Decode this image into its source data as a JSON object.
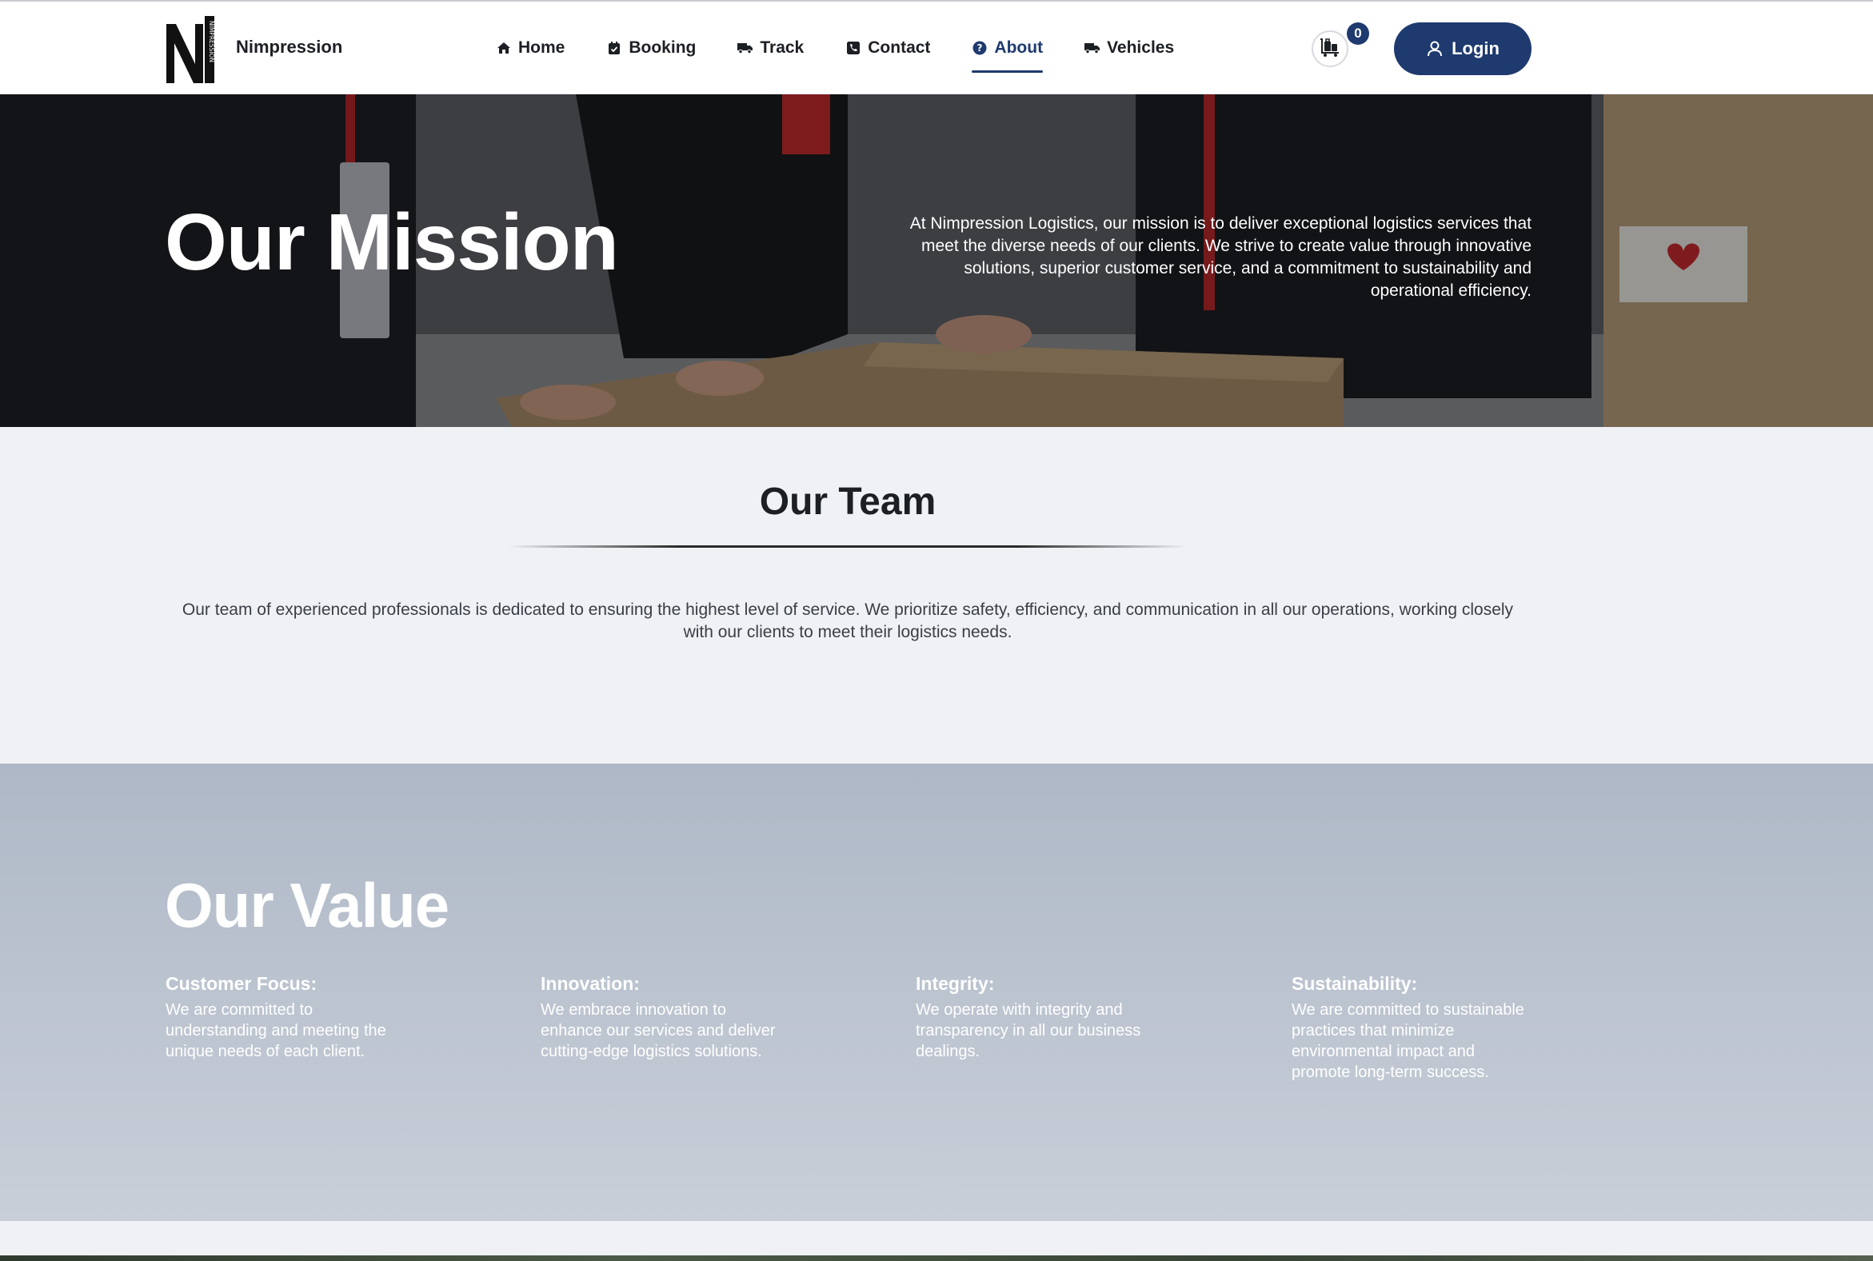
{
  "brand": {
    "name": "Nimpression",
    "logo_vertical_text": "NIMPRESSION"
  },
  "nav": {
    "items": [
      {
        "label": "Home",
        "icon": "home-icon"
      },
      {
        "label": "Booking",
        "icon": "calendar-icon"
      },
      {
        "label": "Track",
        "icon": "truck-icon"
      },
      {
        "label": "Contact",
        "icon": "phone-icon"
      },
      {
        "label": "About",
        "icon": "question-circle-icon",
        "active": true
      },
      {
        "label": "Vehicles",
        "icon": "truck-icon"
      }
    ]
  },
  "cart": {
    "count": "0",
    "icon": "luggage-cart-icon"
  },
  "login": {
    "label": "Login",
    "icon": "user-icon"
  },
  "hero": {
    "title": "Our Mission",
    "text": "At Nimpression Logistics, our mission is to deliver exceptional logistics services that meet the diverse needs of our clients. We strive to create value through innovative solutions, superior customer service, and a commitment to sustainability and operational efficiency."
  },
  "team": {
    "title": "Our Team",
    "text": "Our team of experienced professionals is dedicated to ensuring the highest level of service. We prioritize safety, efficiency, and communication in all our operations, working closely with our clients to meet their logistics needs."
  },
  "value": {
    "title": "Our Value",
    "items": [
      {
        "heading": "Customer Focus:",
        "text": "We are committed to understanding and meeting the unique needs of each client."
      },
      {
        "heading": "Innovation:",
        "text": "We embrace innovation to enhance our services and deliver cutting-edge logistics solutions."
      },
      {
        "heading": "Integrity:",
        "text": "We operate with integrity and transparency in all our business dealings."
      },
      {
        "heading": "Sustainability:",
        "text": "We are committed to sustainable practices that minimize environmental impact and promote long-term success."
      }
    ]
  },
  "colors": {
    "primary": "#1e3a6e",
    "page_bg": "#eff1f5",
    "value_bg": "#b9c2cf"
  }
}
